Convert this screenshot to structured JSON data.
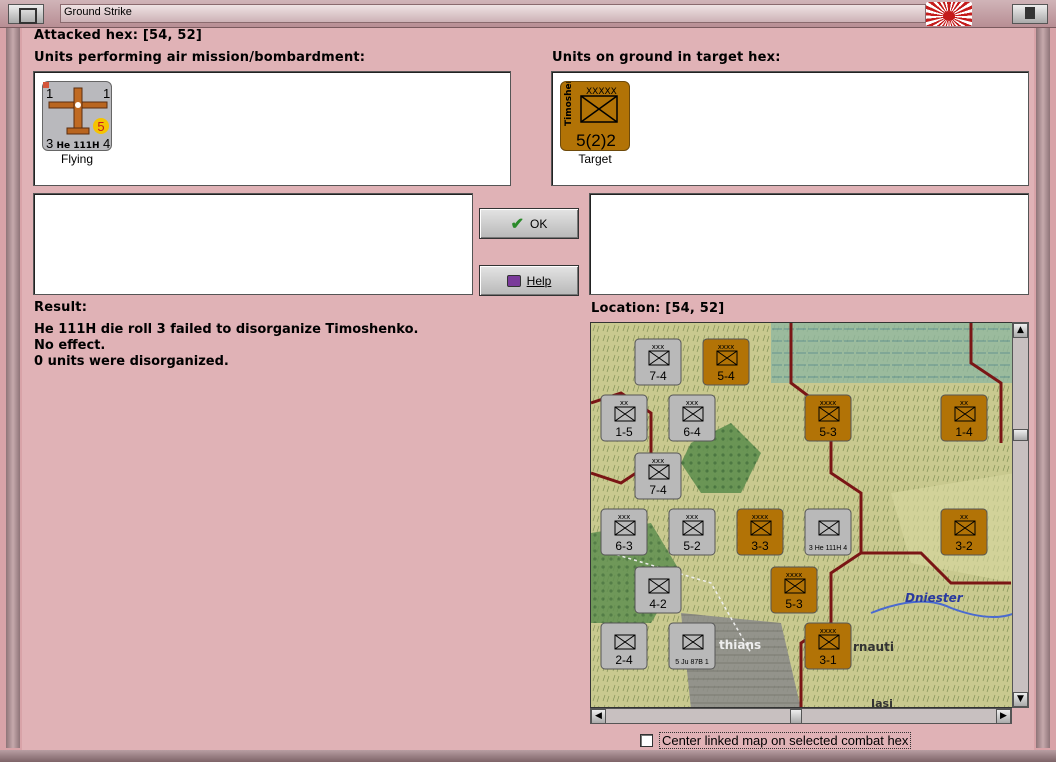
{
  "window": {
    "title": "Ground Strike"
  },
  "attacked_hex": {
    "label": "Attacked hex:",
    "value": "[54, 52]"
  },
  "air_units_panel": {
    "heading": "Units performing air mission/bombardment:",
    "units": [
      {
        "name": "He 111H",
        "attack": "1",
        "defense": "3",
        "range": "4",
        "bomb": "5",
        "status": "Flying"
      }
    ]
  },
  "ground_units_panel": {
    "heading": "Units on ground in target hex:",
    "units": [
      {
        "name": "Timoshen.",
        "size": "XXXXX",
        "strength": "5(2)2",
        "status": "Target"
      }
    ]
  },
  "buttons": {
    "ok_label": "OK",
    "help_label": "Help"
  },
  "result": {
    "label": "Result:",
    "lines": [
      "He 111H die roll 3 failed to disorganize Timoshenko.",
      "No effect.",
      "0 units were disorganized."
    ]
  },
  "location": {
    "label": "Location:",
    "value": "[54, 52]"
  },
  "map": {
    "place_labels": [
      "Dniester",
      "rnauti",
      "thians",
      "Iasi"
    ],
    "counters": [
      {
        "top": "xxx",
        "value": "7-4",
        "color": "#b9b9b9"
      },
      {
        "top": "xxxx",
        "value": "5-4",
        "color": "#b27306"
      },
      {
        "top": "xx",
        "value": "1-5",
        "color": "#b9b9b9"
      },
      {
        "top": "xxx",
        "value": "6-4",
        "color": "#b9b9b9"
      },
      {
        "top": "xxxx",
        "value": "5-3",
        "color": "#b27306"
      },
      {
        "top": "xx",
        "value": "1-4",
        "color": "#b27306"
      },
      {
        "top": "xxx",
        "value": "7-4",
        "color": "#b9b9b9"
      },
      {
        "top": "xxx",
        "value": "6-3",
        "color": "#b9b9b9"
      },
      {
        "top": "xxx",
        "value": "5-2",
        "color": "#b9b9b9"
      },
      {
        "top": "xxxx",
        "value": "3-3",
        "color": "#b27306"
      },
      {
        "top": "",
        "value": "3 He 111H 4",
        "color": "#b9b9b9"
      },
      {
        "top": "xx",
        "value": "3-2",
        "color": "#b27306"
      },
      {
        "top": "",
        "value": "4-2",
        "color": "#b9b9b9"
      },
      {
        "top": "xxxx",
        "value": "5-3",
        "color": "#b27306"
      },
      {
        "top": "",
        "value": "2-4",
        "color": "#b9b9b9"
      },
      {
        "top": "",
        "value": "5 Ju 87B 1",
        "color": "#b9b9b9"
      },
      {
        "top": "xxxx",
        "value": "3-1",
        "color": "#b27306"
      }
    ]
  },
  "center_map_checkbox": {
    "label": "Center linked map on selected combat hex",
    "checked": false
  }
}
